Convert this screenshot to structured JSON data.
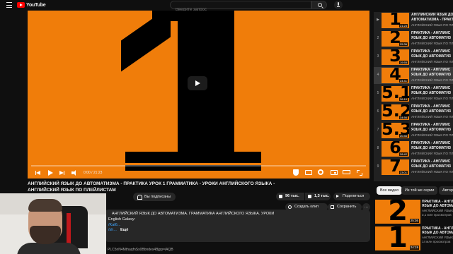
{
  "header": {
    "logo_text": "YouTube",
    "search_placeholder": "Введите запрос"
  },
  "player": {
    "frame_digit": "1",
    "time": "0:00 / 21:23",
    "progress": 0.0
  },
  "video": {
    "title": "АНГЛИЙСКИЙ ЯЗЫК ДО АВТОМАТИЗМА - ПРАКТИКА УРОК 1 ГРАММАТИКА - УРОКИ АНГЛИЙСКОГО ЯЗЫКА - АНГЛИЙСКИЙ ЯЗЫК ПО ПЛЕЙЛИСТАМ",
    "subscribed_label": "Вы подписаны",
    "likes": "96 тыс.",
    "dislikes": "1,3 тыс.",
    "share_label": "Поделиться",
    "clip_label": "Создать клип",
    "save_label": "Сохранить",
    "more_label": "…"
  },
  "description": {
    "line1": "АНГЛИЙСКИЙ ЯЗЫК ДО АВТОМАТИЗМА. ГРАММАТИКА АНГЛИЙСКОГО ЯЗЫКА. УРОКИ",
    "line2": "English Galaxy:",
    "line3": "/Kat6...",
    "line4": "/sh...",
    "more_label": "Ещё",
    "url_text": "PLC5nN4MthaqfnSs0Bbndes4Bjpp=iAQB"
  },
  "playlist": {
    "items": [
      {
        "index": "▶",
        "digit": "1",
        "duration": "21:23",
        "title": "АНГЛИЙСКИЙ ЯЗЫК ДО",
        "title2": "АВТОМАТИЗМА - ПРАКТ",
        "channel": "АНГЛИЙСКИЙ ЯЗЫК ПО ПЛ"
      },
      {
        "index": "2",
        "digit": "2",
        "duration": "25:36",
        "title": "ПРАКТИКА - АНГЛИЙС",
        "title2": "ЯЗЫК ДО АВТОМАТИЗ",
        "channel": "АНГЛИЙСКИЙ ЯЗЫК ПО ПЛ"
      },
      {
        "index": "3",
        "digit": "3",
        "duration": "19:55",
        "title": "ПРАКТИКА - АНГЛИЙС",
        "title2": "ЯЗЫК ДО АВТОМАТИЗ",
        "channel": "АНГЛИЙСКИЙ ЯЗЫК ПО ПЛ"
      },
      {
        "index": "4",
        "digit": "4",
        "duration": "24:41",
        "title": "ПРАКТИКА - АНГЛИЙС",
        "title2": "ЯЗЫК ДО АВТОМАТИЗ",
        "channel": "АНГЛИЙСКИЙ ЯЗЫК ПО ПЛ"
      },
      {
        "index": "5",
        "digit": "5.1",
        "duration": "36:10",
        "title": "ПРАКТИКА - АНГЛИЙС",
        "title2": "ЯЗЫК ДО АВТОМАТИЗ",
        "channel": "АНГЛИЙСКИЙ ЯЗЫК ПО ПЛ"
      },
      {
        "index": "6",
        "digit": "5.2",
        "duration": "34:56",
        "title": "ПРАКТИКА - АНГЛИЙС",
        "title2": "ЯЗЫК ДО АВТОМАТИЗ",
        "channel": "АНГЛИЙСКИЙ ЯЗЫК ПО ПЛ"
      },
      {
        "index": "7",
        "digit": "5.3",
        "duration": "20:46",
        "title": "ПРАКТИКА - АНГЛИЙС",
        "title2": "ЯЗЫК ДО АВТОМАТИЗ",
        "channel": "АНГЛИЙСКИЙ ЯЗЫК ПО ПЛ"
      },
      {
        "index": "8",
        "digit": "6",
        "duration": "28:42",
        "title": "ПРАКТИКА - АНГЛИЙС",
        "title2": "ЯЗЫК ДО АВТОМАТИЗ",
        "channel": "АНГЛИЙСКИЙ ЯЗЫК ПО ПЛ"
      },
      {
        "index": "9",
        "digit": "7",
        "duration": "23:01",
        "title": "ПРАКТИКА - АНГЛИЙС",
        "title2": "ЯЗЫК ДО АВТОМАТИЗ",
        "channel": "АНГЛИЙСКИЙ ЯЗЫК ПО ПЛ"
      }
    ]
  },
  "chips": [
    "Все видео",
    "Из той же серии",
    "Автор"
  ],
  "recommended": [
    {
      "digit": "2",
      "duration": "25:36",
      "title": "ПРАКТИКА - АНГЛИЙ",
      "title2": "ЯЗЫК ДО АВТОМАТ",
      "channel": "АНГЛИЙСКИЙ ЯЗЫК",
      "views": "3,1 млн просмотров"
    },
    {
      "digit": "1",
      "duration": "24:19",
      "title": "ПРАКТИКА - АНГЛИЙ",
      "title2": "ЯЗЫК ДО АВТОМАТ",
      "channel": "АНГЛИЙСКИЙ ЯЗЫК",
      "views": "14 млн просмотров"
    }
  ]
}
